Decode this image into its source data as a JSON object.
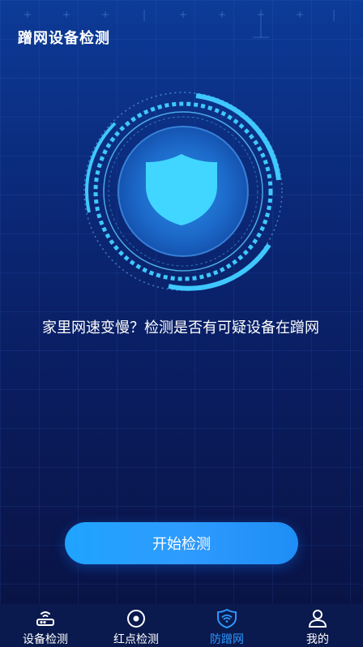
{
  "header": {
    "title": "蹭网设备检测"
  },
  "main": {
    "description": "家里网速变慢？检测是否有可疑设备在蹭网",
    "start_button": "开始检测"
  },
  "icons": {
    "shield": "shield-icon",
    "router": "router-icon",
    "target": "target-icon",
    "wifi_shield": "wifi-shield-icon",
    "user": "user-icon"
  },
  "tabbar": {
    "items": [
      {
        "label": "设备检测",
        "icon": "router-icon",
        "active": false
      },
      {
        "label": "红点检测",
        "icon": "target-icon",
        "active": false
      },
      {
        "label": "防蹭网",
        "icon": "wifi-shield-icon",
        "active": true
      },
      {
        "label": "我的",
        "icon": "user-icon",
        "active": false
      }
    ]
  },
  "colors": {
    "accent": "#2c98ff",
    "shield": "#41d6ff",
    "ring": "#3fc8ff",
    "tab_background": "#0a1a4e"
  }
}
